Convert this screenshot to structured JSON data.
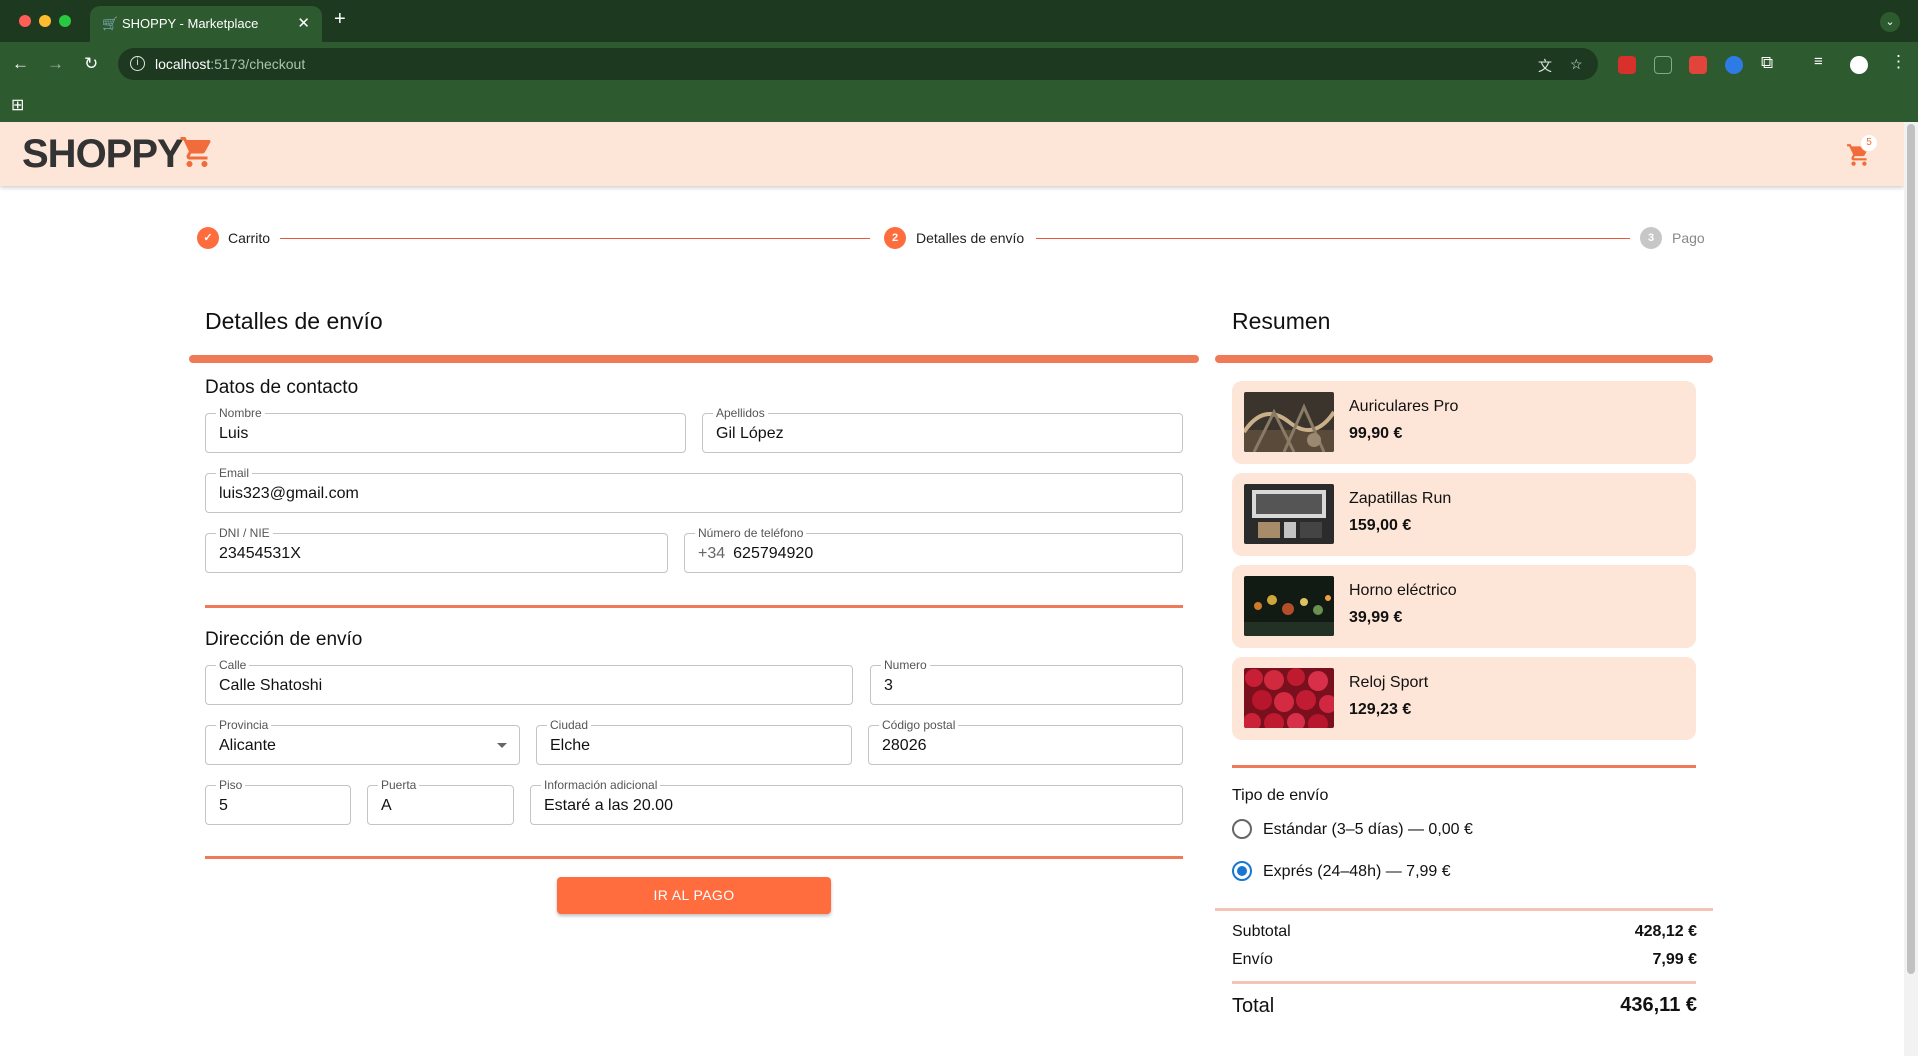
{
  "browser": {
    "tab_title": "SHOPPY - Marketplace",
    "url_host": "localhost",
    "url_rest": ":5173/checkout"
  },
  "header": {
    "logo": "SHOPPY",
    "cart_count": "5"
  },
  "stepper": {
    "steps": [
      {
        "label": "Carrito",
        "state": "done"
      },
      {
        "label": "Detalles de envío",
        "number": "2",
        "state": "active"
      },
      {
        "label": "Pago",
        "number": "3",
        "state": "pending"
      }
    ]
  },
  "form": {
    "title": "Detalles de envío",
    "contact_title": "Datos de contacto",
    "address_title": "Dirección de envío",
    "nombre": {
      "label": "Nombre",
      "value": "Luis"
    },
    "apellidos": {
      "label": "Apellidos",
      "value": "Gil López"
    },
    "email": {
      "label": "Email",
      "value": "luis323@gmail.com"
    },
    "dni": {
      "label": "DNI / NIE",
      "value": "23454531X"
    },
    "telefono": {
      "label": "Número de teléfono",
      "prefix": "+34",
      "value": "625794920"
    },
    "calle": {
      "label": "Calle",
      "value": "Calle Shatoshi"
    },
    "numero": {
      "label": "Numero",
      "value": "3"
    },
    "provincia": {
      "label": "Provincia",
      "value": "Alicante"
    },
    "ciudad": {
      "label": "Ciudad",
      "value": "Elche"
    },
    "codigo_postal": {
      "label": "Código postal",
      "value": "28026"
    },
    "piso": {
      "label": "Piso",
      "value": "5"
    },
    "puerta": {
      "label": "Puerta",
      "value": "A"
    },
    "info_adicional": {
      "label": "Información adicional",
      "value": "Estaré a las 20.00"
    },
    "submit_label": "IR AL PAGO"
  },
  "summary": {
    "title": "Resumen",
    "items": [
      {
        "name": "Auriculares Pro",
        "price": "99,90 €"
      },
      {
        "name": "Zapatillas Run",
        "price": "159,00 €"
      },
      {
        "name": "Horno eléctrico",
        "price": "39,99 €"
      },
      {
        "name": "Reloj Sport",
        "price": "129,23 €"
      }
    ],
    "shipping_title": "Tipo de envío",
    "shipping_options": [
      {
        "label": "Estándar (3–5 días) — 0,00 €",
        "selected": false
      },
      {
        "label": "Exprés (24–48h) — 7,99 €",
        "selected": true
      }
    ],
    "subtotal_label": "Subtotal",
    "subtotal_value": "428,12 €",
    "envio_label": "Envío",
    "envio_value": "7,99 €",
    "total_label": "Total",
    "total_value": "436,11 €"
  },
  "colors": {
    "accent": "#ff6c3d",
    "header_bg": "#fde6d8",
    "browser_frame": "#2d5a2f",
    "radio_selected": "#1976d2"
  }
}
